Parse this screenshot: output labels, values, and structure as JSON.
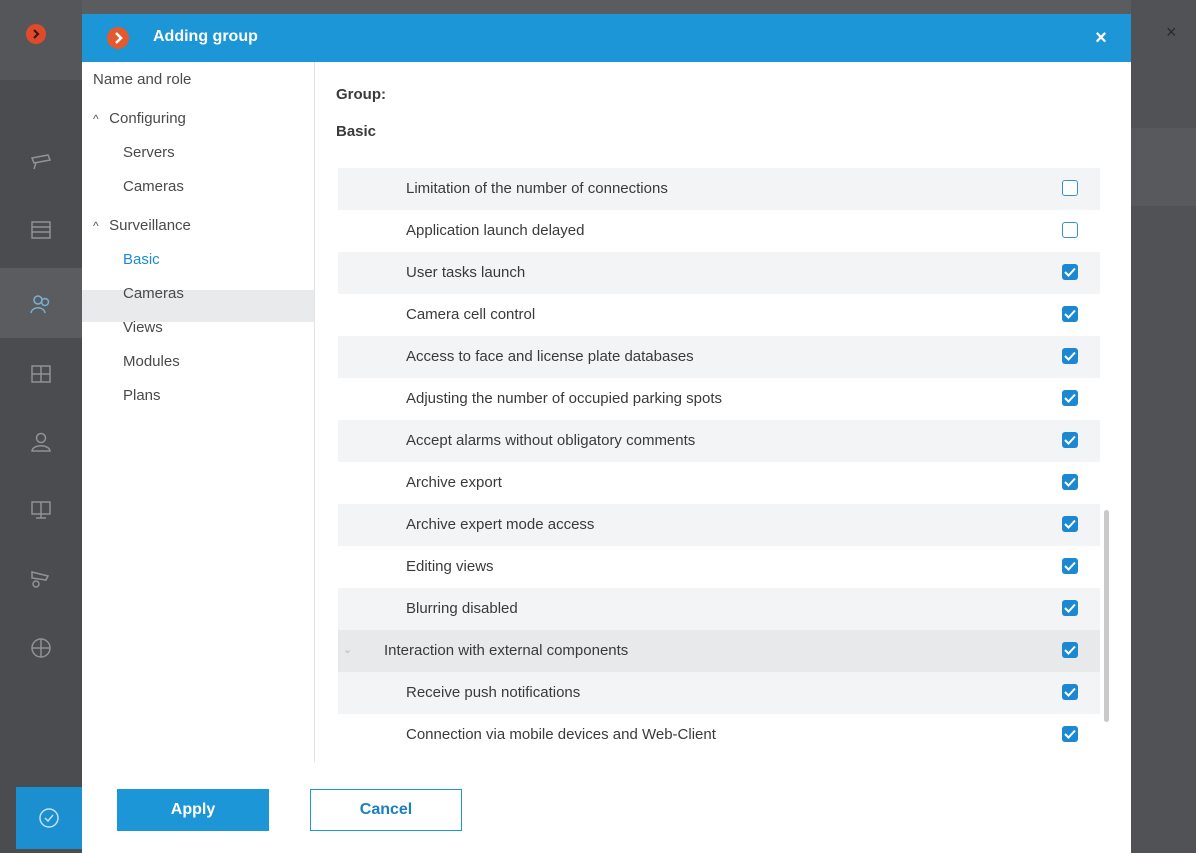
{
  "dialog": {
    "title": "Adding group",
    "close_symbol": "×"
  },
  "background": {
    "close_symbol": "×",
    "sidebar_icons": [
      "logo-icon",
      "camera-icon",
      "list-icon",
      "users-icon",
      "layout-icon",
      "user-icon",
      "monitor-icon",
      "camera-settings-icon",
      "globe-icon",
      "check-circle-icon"
    ]
  },
  "nav": {
    "name_and_role": "Name and role",
    "configuring": "Configuring",
    "configuring_items": [
      "Servers",
      "Cameras"
    ],
    "surveillance": "Surveillance",
    "surveillance_items": [
      "Basic",
      "Cameras",
      "Views",
      "Modules",
      "Plans"
    ],
    "selected": "Basic"
  },
  "content": {
    "group_label": "Group:",
    "section_label": "Basic",
    "rows": [
      {
        "label": "Limitation of the number of connections",
        "checked": false
      },
      {
        "label": "Application launch delayed",
        "checked": false
      },
      {
        "label": "User tasks launch",
        "checked": true
      },
      {
        "label": "Camera cell control",
        "checked": true
      },
      {
        "label": "Access to face and license plate databases",
        "checked": true
      },
      {
        "label": "Adjusting the number of occupied parking spots",
        "checked": true
      },
      {
        "label": "Accept alarms without obligatory comments",
        "checked": true
      },
      {
        "label": "Archive export",
        "checked": true
      },
      {
        "label": "Archive expert mode access",
        "checked": true
      },
      {
        "label": "Editing views",
        "checked": true
      },
      {
        "label": "Blurring disabled",
        "checked": true
      },
      {
        "label": "Interaction with external components",
        "checked": true,
        "section": true
      },
      {
        "label": "Receive push notifications",
        "checked": true
      },
      {
        "label": "Connection via mobile devices and Web-Client",
        "checked": true
      }
    ]
  },
  "buttons": {
    "apply": "Apply",
    "cancel": "Cancel"
  },
  "colors": {
    "accent": "#1d96d7",
    "checkbox": "#1d88d2",
    "brand_logo": "#e45a2c"
  }
}
